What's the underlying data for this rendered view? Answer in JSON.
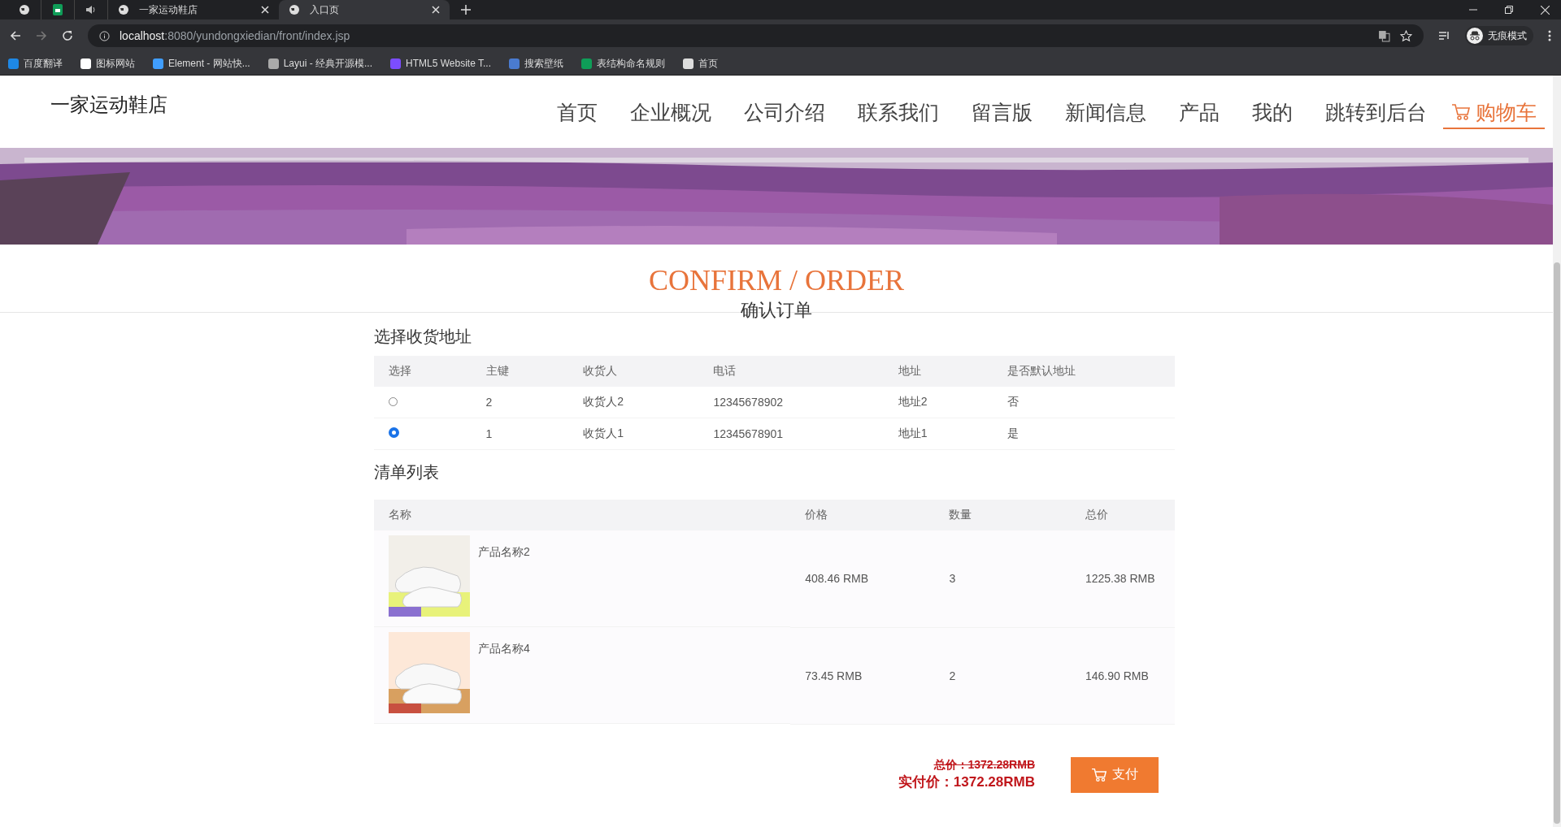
{
  "browser": {
    "tabs": [
      {
        "kind": "pinned",
        "selected": false
      },
      {
        "kind": "pinned",
        "selected": false
      },
      {
        "kind": "pinned",
        "selected": false
      },
      {
        "kind": "full",
        "label": "一家运动鞋店",
        "selected": false
      },
      {
        "kind": "full",
        "label": "入口页",
        "selected": true
      }
    ],
    "url_host": "localhost",
    "url_rest": ":8080/yundongxiedian/front/index.jsp",
    "profile": "无痕模式",
    "bookmarks": [
      {
        "label": "百度翻译",
        "color": "#1e88e5"
      },
      {
        "label": "图标网站",
        "color": "#ffffff"
      },
      {
        "label": "Element - 网站快...",
        "color": "#409eff"
      },
      {
        "label": "Layui - 经典开源模...",
        "color": "#aaaaaa"
      },
      {
        "label": "HTML5 Website T...",
        "color": "#7c4dff"
      },
      {
        "label": "搜索壁纸",
        "color": "#4a7bd0"
      },
      {
        "label": "表结构命名规则",
        "color": "#0f9d58"
      },
      {
        "label": "首页",
        "color": "#dddddd"
      }
    ]
  },
  "site": {
    "logo": "一家运动鞋店",
    "nav": [
      {
        "label": "首页",
        "selected": false
      },
      {
        "label": "企业概况",
        "selected": false
      },
      {
        "label": "公司介绍",
        "selected": false
      },
      {
        "label": "联系我们",
        "selected": false
      },
      {
        "label": "留言版",
        "selected": false
      },
      {
        "label": "新闻信息",
        "selected": false
      },
      {
        "label": "产品",
        "selected": false
      },
      {
        "label": "我的",
        "selected": false
      },
      {
        "label": "跳转到后台",
        "selected": false
      },
      {
        "label": "购物车",
        "selected": true
      }
    ]
  },
  "page": {
    "title": "CONFIRM / ORDER",
    "subtitle": "确认订单"
  },
  "address": {
    "heading": "选择收货地址",
    "columns": [
      "选择",
      "主键",
      "收货人",
      "电话",
      "地址",
      "是否默认地址"
    ],
    "rows": [
      {
        "selected": false,
        "cells": [
          "",
          "2",
          "收货人2",
          "12345678902",
          "地址2",
          "否"
        ]
      },
      {
        "selected": true,
        "cells": [
          "",
          "1",
          "收货人1",
          "12345678901",
          "地址1",
          "是"
        ]
      }
    ]
  },
  "items": {
    "heading": "清单列表",
    "columns": [
      "名称",
      "价格",
      "数量",
      "总价"
    ],
    "rows": [
      {
        "name": "产品名称2",
        "price": "408.46 RMB",
        "qty": "3",
        "total": "1225.38 RMB"
      },
      {
        "name": "产品名称4",
        "price": "73.45 RMB",
        "qty": "2",
        "total": "146.90 RMB"
      }
    ]
  },
  "summary": {
    "total": "总价：1372.28RMB",
    "paid": "实付价：1372.28RMB",
    "pay_button": "支付"
  }
}
